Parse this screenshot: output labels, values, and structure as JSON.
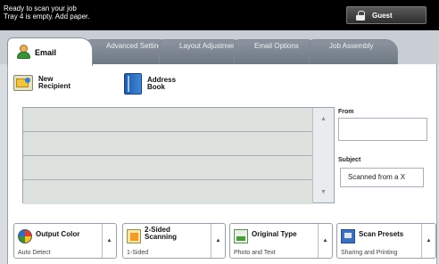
{
  "status": {
    "line1": "Ready to scan your job",
    "line2": "Tray 4 is empty. Add paper.",
    "guest_label": "Guest"
  },
  "tabs": [
    {
      "label": "Email",
      "active": true
    },
    {
      "label": "Advanced Settings",
      "active": false
    },
    {
      "label": "Layout Adjustment",
      "active": false
    },
    {
      "label": "Email Options",
      "active": false
    },
    {
      "label": "Job Assembly",
      "active": false
    }
  ],
  "actions": {
    "new_recipient": "New Recipient",
    "address_book": "Address Book"
  },
  "fields": {
    "from_label": "From",
    "from_value": "",
    "subject_label": "Subject",
    "subject_value": "Scanned from a X"
  },
  "features": [
    {
      "title": "Output Color",
      "value": "Auto Detect"
    },
    {
      "title": "2-Sided Scanning",
      "value": "1-Sided"
    },
    {
      "title": "Original Type",
      "value": "Photo and Text"
    },
    {
      "title": "Scan Presets",
      "value": "Sharing and Printing"
    }
  ],
  "colors": {
    "tab_inactive": "#6e7882",
    "panel_bg": "#ffffff",
    "status_bar": "#000000",
    "list_row": "#dde2de"
  }
}
